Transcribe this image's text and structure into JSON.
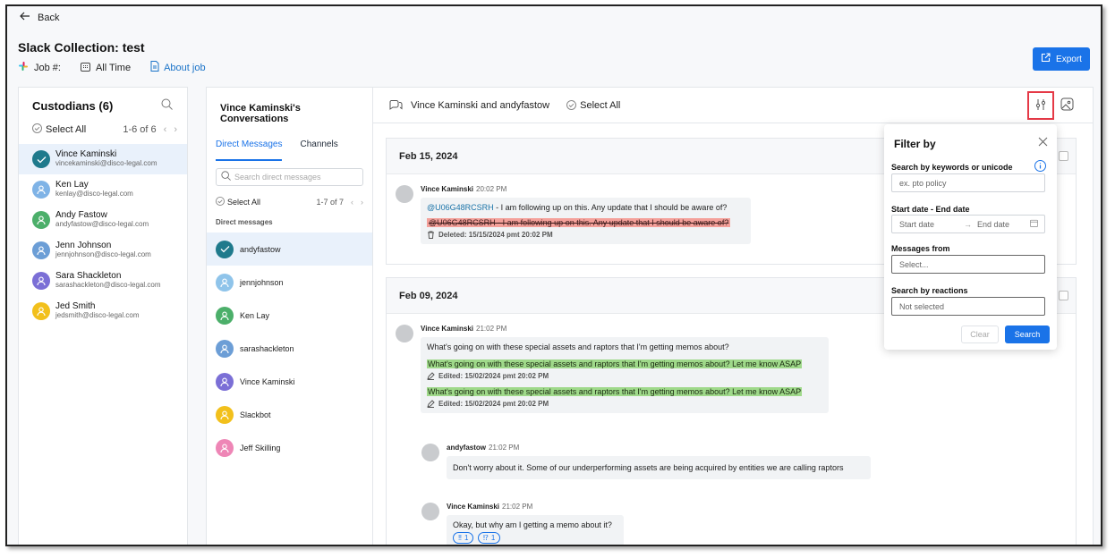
{
  "nav": {
    "back_label": "Back"
  },
  "header": {
    "title": "Slack Collection: test",
    "job_label": "Job #:",
    "time_range": "All Time",
    "about_label": "About job",
    "export_label": "Export"
  },
  "custodians": {
    "title": "Custodians (6)",
    "select_all": "Select All",
    "pagination": "1-6 of 6",
    "items": [
      {
        "name": "Vince Kaminski",
        "email": "vincekaminski@disco-legal.com",
        "color": "#1f7a8c",
        "checked": true
      },
      {
        "name": "Ken Lay",
        "email": "kenlay@disco-legal.com",
        "color": "#7fb3e6",
        "checked": false
      },
      {
        "name": "Andy Fastow",
        "email": "andyfastow@disco-legal.com",
        "color": "#4caf6a",
        "checked": false
      },
      {
        "name": "Jenn Johnson",
        "email": "jennjohnson@disco-legal.com",
        "color": "#6c9ed6",
        "checked": false
      },
      {
        "name": "Sara Shackleton",
        "email": "sarashackleton@disco-legal.com",
        "color": "#7b6fd6",
        "checked": false
      },
      {
        "name": "Jed Smith",
        "email": "jedsmith@disco-legal.com",
        "color": "#f2c01c",
        "checked": false
      }
    ]
  },
  "conversations": {
    "title": "Vince Kaminski's Conversations",
    "tabs": [
      "Direct Messages",
      "Channels"
    ],
    "search_placeholder": "Search direct messages",
    "select_all": "Select All",
    "pagination": "1-7 of 7",
    "section_label": "Direct messages",
    "items": [
      {
        "name": "andyfastow",
        "color": "#1f7a8c",
        "checked": true
      },
      {
        "name": "jennjohnson",
        "color": "#8fc4ea",
        "checked": false
      },
      {
        "name": "Ken Lay",
        "color": "#4caf6a",
        "checked": false
      },
      {
        "name": "sarashackleton",
        "color": "#6c9ed6",
        "checked": false
      },
      {
        "name": "Vince Kaminski",
        "color": "#7b6fd6",
        "checked": false
      },
      {
        "name": "Slackbot",
        "color": "#f2c01c",
        "checked": false
      },
      {
        "name": "Jeff Skilling",
        "color": "#ee86b6",
        "checked": false
      }
    ]
  },
  "main": {
    "conversation_title": "Vince Kaminski and andyfastow",
    "select_all": "Select All",
    "days": [
      {
        "date": "Feb 15, 2024",
        "messages": [
          {
            "author": "Vince Kaminski",
            "time": "20:02 PM",
            "mention": "@U06G48RCSRH",
            "text": " - I am following up on this. Any update that I should be aware of?",
            "deleted_text": "@U06G48RCSRH  - I am following up on this. Any update that I should be aware of?",
            "deleted_note": "Deleted: 15/15/2024 pmt 20:02 PM"
          }
        ]
      },
      {
        "date": "Feb 09, 2024",
        "messages": [
          {
            "author": "Vince Kaminski",
            "time": "21:02 PM",
            "text": "What's going on with these special assets and raptors that I'm getting memos about?",
            "edit1": "What's going on with these special assets and raptors that I'm getting memos about? Let me know ASAP",
            "edit1_note": "Edited: 15/02/2024 pmt 20:02 PM",
            "edit2": "What's going on with these special assets and raptors that I'm getting memos about? Let me know ASAP",
            "edit2_note": "Edited: 15/02/2024 pmt 20:02 PM"
          },
          {
            "author": "andyfastow",
            "time": "21:02 PM",
            "text": "Don't worry about it. Some of our underperforming assets are being acquired by entities we are calling raptors"
          },
          {
            "author": "Vince Kaminski",
            "time": "21:02 PM",
            "text": "Okay, but why am I getting a memo about it?",
            "reactions": [
              {
                "emoji": "‼",
                "count": "1"
              },
              {
                "emoji": "⁉",
                "count": "1"
              }
            ]
          }
        ]
      }
    ]
  },
  "filter": {
    "title": "Filter by",
    "keywords_label": "Search by keywords or unicode",
    "keywords_placeholder": "ex. pto policy",
    "date_label": "Start date - End date",
    "start_placeholder": "Start date",
    "end_placeholder": "End date",
    "from_label": "Messages from",
    "from_placeholder": "Select...",
    "reactions_label": "Search by reactions",
    "reactions_value": "Not selected",
    "clear_label": "Clear",
    "search_label": "Search"
  },
  "colors": {
    "accent": "#1a73e8",
    "highlight_border": "#e53946",
    "deleted_bg": "#f4a09a",
    "edited_bg": "#9fd98a"
  }
}
